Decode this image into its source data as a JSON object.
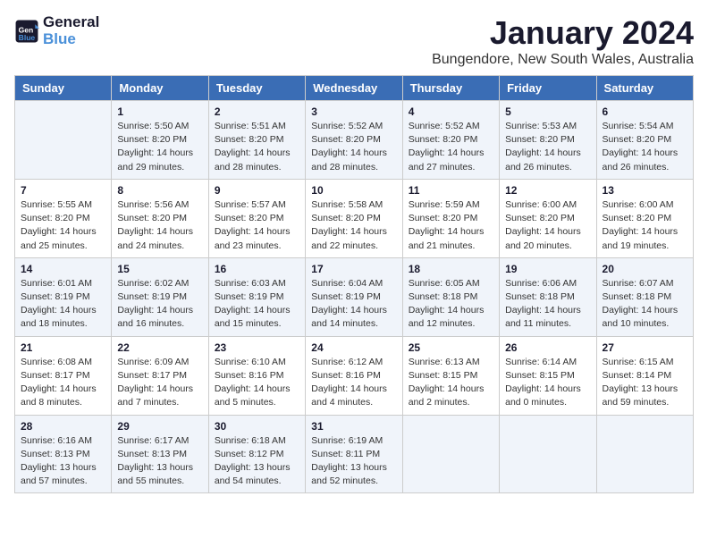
{
  "logo": {
    "line1": "General",
    "line2": "Blue"
  },
  "title": "January 2024",
  "subtitle": "Bungendore, New South Wales, Australia",
  "headers": [
    "Sunday",
    "Monday",
    "Tuesday",
    "Wednesday",
    "Thursday",
    "Friday",
    "Saturday"
  ],
  "weeks": [
    [
      {
        "day": "",
        "info": ""
      },
      {
        "day": "1",
        "info": "Sunrise: 5:50 AM\nSunset: 8:20 PM\nDaylight: 14 hours\nand 29 minutes."
      },
      {
        "day": "2",
        "info": "Sunrise: 5:51 AM\nSunset: 8:20 PM\nDaylight: 14 hours\nand 28 minutes."
      },
      {
        "day": "3",
        "info": "Sunrise: 5:52 AM\nSunset: 8:20 PM\nDaylight: 14 hours\nand 28 minutes."
      },
      {
        "day": "4",
        "info": "Sunrise: 5:52 AM\nSunset: 8:20 PM\nDaylight: 14 hours\nand 27 minutes."
      },
      {
        "day": "5",
        "info": "Sunrise: 5:53 AM\nSunset: 8:20 PM\nDaylight: 14 hours\nand 26 minutes."
      },
      {
        "day": "6",
        "info": "Sunrise: 5:54 AM\nSunset: 8:20 PM\nDaylight: 14 hours\nand 26 minutes."
      }
    ],
    [
      {
        "day": "7",
        "info": "Sunrise: 5:55 AM\nSunset: 8:20 PM\nDaylight: 14 hours\nand 25 minutes."
      },
      {
        "day": "8",
        "info": "Sunrise: 5:56 AM\nSunset: 8:20 PM\nDaylight: 14 hours\nand 24 minutes."
      },
      {
        "day": "9",
        "info": "Sunrise: 5:57 AM\nSunset: 8:20 PM\nDaylight: 14 hours\nand 23 minutes."
      },
      {
        "day": "10",
        "info": "Sunrise: 5:58 AM\nSunset: 8:20 PM\nDaylight: 14 hours\nand 22 minutes."
      },
      {
        "day": "11",
        "info": "Sunrise: 5:59 AM\nSunset: 8:20 PM\nDaylight: 14 hours\nand 21 minutes."
      },
      {
        "day": "12",
        "info": "Sunrise: 6:00 AM\nSunset: 8:20 PM\nDaylight: 14 hours\nand 20 minutes."
      },
      {
        "day": "13",
        "info": "Sunrise: 6:00 AM\nSunset: 8:20 PM\nDaylight: 14 hours\nand 19 minutes."
      }
    ],
    [
      {
        "day": "14",
        "info": "Sunrise: 6:01 AM\nSunset: 8:19 PM\nDaylight: 14 hours\nand 18 minutes."
      },
      {
        "day": "15",
        "info": "Sunrise: 6:02 AM\nSunset: 8:19 PM\nDaylight: 14 hours\nand 16 minutes."
      },
      {
        "day": "16",
        "info": "Sunrise: 6:03 AM\nSunset: 8:19 PM\nDaylight: 14 hours\nand 15 minutes."
      },
      {
        "day": "17",
        "info": "Sunrise: 6:04 AM\nSunset: 8:19 PM\nDaylight: 14 hours\nand 14 minutes."
      },
      {
        "day": "18",
        "info": "Sunrise: 6:05 AM\nSunset: 8:18 PM\nDaylight: 14 hours\nand 12 minutes."
      },
      {
        "day": "19",
        "info": "Sunrise: 6:06 AM\nSunset: 8:18 PM\nDaylight: 14 hours\nand 11 minutes."
      },
      {
        "day": "20",
        "info": "Sunrise: 6:07 AM\nSunset: 8:18 PM\nDaylight: 14 hours\nand 10 minutes."
      }
    ],
    [
      {
        "day": "21",
        "info": "Sunrise: 6:08 AM\nSunset: 8:17 PM\nDaylight: 14 hours\nand 8 minutes."
      },
      {
        "day": "22",
        "info": "Sunrise: 6:09 AM\nSunset: 8:17 PM\nDaylight: 14 hours\nand 7 minutes."
      },
      {
        "day": "23",
        "info": "Sunrise: 6:10 AM\nSunset: 8:16 PM\nDaylight: 14 hours\nand 5 minutes."
      },
      {
        "day": "24",
        "info": "Sunrise: 6:12 AM\nSunset: 8:16 PM\nDaylight: 14 hours\nand 4 minutes."
      },
      {
        "day": "25",
        "info": "Sunrise: 6:13 AM\nSunset: 8:15 PM\nDaylight: 14 hours\nand 2 minutes."
      },
      {
        "day": "26",
        "info": "Sunrise: 6:14 AM\nSunset: 8:15 PM\nDaylight: 14 hours\nand 0 minutes."
      },
      {
        "day": "27",
        "info": "Sunrise: 6:15 AM\nSunset: 8:14 PM\nDaylight: 13 hours\nand 59 minutes."
      }
    ],
    [
      {
        "day": "28",
        "info": "Sunrise: 6:16 AM\nSunset: 8:13 PM\nDaylight: 13 hours\nand 57 minutes."
      },
      {
        "day": "29",
        "info": "Sunrise: 6:17 AM\nSunset: 8:13 PM\nDaylight: 13 hours\nand 55 minutes."
      },
      {
        "day": "30",
        "info": "Sunrise: 6:18 AM\nSunset: 8:12 PM\nDaylight: 13 hours\nand 54 minutes."
      },
      {
        "day": "31",
        "info": "Sunrise: 6:19 AM\nSunset: 8:11 PM\nDaylight: 13 hours\nand 52 minutes."
      },
      {
        "day": "",
        "info": ""
      },
      {
        "day": "",
        "info": ""
      },
      {
        "day": "",
        "info": ""
      }
    ]
  ]
}
